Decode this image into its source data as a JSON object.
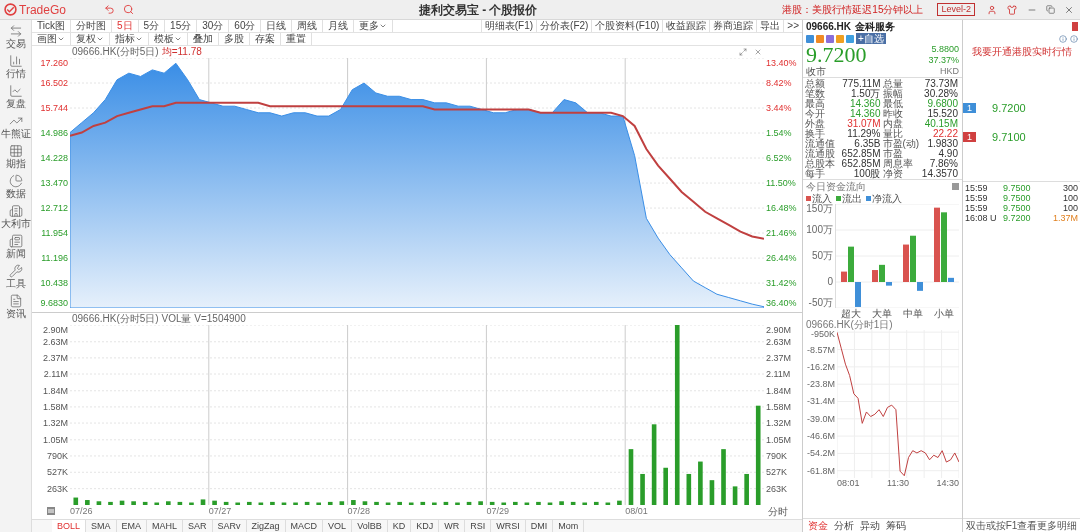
{
  "app": {
    "logo": "TradeGo",
    "title": "捷利交易宝 - 个股报价",
    "notice": "港股：美股行情延迟15分钟以上",
    "level_button": "Level-2"
  },
  "sidebar": [
    {
      "label": "交易",
      "selected": false
    },
    {
      "label": "行情",
      "selected": false
    },
    {
      "label": "复盘",
      "selected": false
    },
    {
      "label": "牛熊证",
      "selected": false
    },
    {
      "label": "期指",
      "selected": false
    },
    {
      "label": "数据",
      "selected": false
    },
    {
      "label": "大利市",
      "selected": false
    },
    {
      "label": "新闻",
      "selected": false
    },
    {
      "label": "工具",
      "selected": false
    },
    {
      "label": "资讯",
      "selected": false
    }
  ],
  "periods": [
    {
      "label": "Tick图",
      "selected": false,
      "kind": "plain"
    },
    {
      "label": "分时图",
      "selected": false,
      "kind": "plain"
    },
    {
      "label": "5日",
      "selected": true,
      "kind": "plain"
    },
    {
      "label": "5分",
      "selected": false,
      "kind": "plain"
    },
    {
      "label": "15分",
      "selected": false,
      "kind": "plain"
    },
    {
      "label": "30分",
      "selected": false,
      "kind": "plain"
    },
    {
      "label": "60分",
      "selected": false,
      "kind": "plain"
    },
    {
      "label": "日线",
      "selected": false,
      "kind": "plain"
    },
    {
      "label": "周线",
      "selected": false,
      "kind": "plain"
    },
    {
      "label": "月线",
      "selected": false,
      "kind": "plain"
    },
    {
      "label": "更多",
      "selected": false,
      "kind": "dropdown"
    }
  ],
  "panel_buttons": [
    "明细表(F1)",
    "分价表(F2)",
    "个股资料(F10)",
    "收益跟踪",
    "券商追踪",
    "导出",
    ">>"
  ],
  "tools": [
    {
      "label": "画图",
      "kind": "dropdown"
    },
    {
      "label": "复权",
      "kind": "dropdown"
    },
    {
      "label": "指标",
      "kind": "dropdown"
    },
    {
      "label": "模板",
      "kind": "dropdown"
    },
    {
      "label": "叠加",
      "kind": "plain"
    },
    {
      "label": "多股",
      "kind": "plain"
    },
    {
      "label": "存案",
      "kind": "plain"
    },
    {
      "label": "重置",
      "kind": "plain"
    }
  ],
  "price_chart": {
    "title": "09666.HK(分时5日)",
    "average": "均=11.78",
    "right_axis": [
      {
        "label": "13.40%",
        "fall": false
      },
      {
        "label": "8.42%",
        "fall": false
      },
      {
        "label": "3.44%",
        "fall": false
      },
      {
        "label": "1.54%",
        "fall": true
      },
      {
        "label": "6.52%",
        "fall": true
      },
      {
        "label": "11.50%",
        "fall": true
      },
      {
        "label": "16.48%",
        "fall": true
      },
      {
        "label": "21.46%",
        "fall": true
      },
      {
        "label": "26.44%",
        "fall": true
      },
      {
        "label": "31.42%",
        "fall": true
      },
      {
        "label": "36.40%",
        "fall": true
      }
    ],
    "chart_data": {
      "type": "area",
      "grid": true,
      "ylim": [
        9.683,
        17.26
      ],
      "yticks": [
        {
          "value": 17.26,
          "label": "17.260"
        },
        {
          "value": 16.502,
          "label": "16.502"
        },
        {
          "value": 15.744,
          "label": "15.744"
        },
        {
          "value": 14.986,
          "label": "14.986"
        },
        {
          "value": 14.228,
          "label": "14.228"
        },
        {
          "value": 13.47,
          "label": "13.470"
        },
        {
          "value": 12.712,
          "label": "12.712"
        },
        {
          "value": 11.954,
          "label": "11.954"
        },
        {
          "value": 11.196,
          "label": "11.196"
        },
        {
          "value": 10.438,
          "label": "10.438"
        },
        {
          "value": 9.683,
          "label": "9.6830"
        }
      ],
      "series": [
        {
          "type": "area",
          "color": "#3a8ee6",
          "values": [
            15.0,
            15.3,
            15.6,
            16.0,
            16.6,
            16.8,
            16.7,
            16.9,
            16.8,
            17.1,
            16.6,
            16.0,
            15.9,
            15.8,
            15.8,
            15.7,
            15.6,
            15.6,
            15.5,
            15.6,
            15.6,
            15.5,
            15.5,
            15.7,
            16.3,
            16.5,
            16.2,
            16.1,
            16.1,
            16.0,
            16.0,
            15.9,
            15.9,
            15.8,
            15.8,
            15.7,
            15.6,
            15.6,
            15.7,
            15.7,
            15.6,
            15.6,
            16.0,
            15.9,
            15.6,
            15.6,
            15.5,
            15.5,
            14.3,
            12.4,
            11.8,
            11.3,
            10.9,
            10.5,
            10.3,
            10.1,
            10.0,
            9.9,
            9.8,
            9.72
          ]
        },
        {
          "type": "line",
          "color": "#c04040",
          "values": [
            14.9,
            15.0,
            15.2,
            15.3,
            15.5,
            15.6,
            15.7,
            15.8,
            15.8,
            15.9,
            15.9,
            15.9,
            15.9,
            15.9,
            15.9,
            15.9,
            15.9,
            15.8,
            15.8,
            15.8,
            15.8,
            15.8,
            15.8,
            15.8,
            15.8,
            15.8,
            15.8,
            15.8,
            15.8,
            15.8,
            15.8,
            15.7,
            15.7,
            15.7,
            15.7,
            15.7,
            15.7,
            15.7,
            15.7,
            15.7,
            15.6,
            15.6,
            15.6,
            15.6,
            15.6,
            15.6,
            15.6,
            15.5,
            15.2,
            14.5,
            14.0,
            13.6,
            13.2,
            12.9,
            12.6,
            12.4,
            12.2,
            12.0,
            11.85,
            11.78
          ]
        }
      ]
    }
  },
  "volume_chart": {
    "title": "09666.HK(分时5日) VOL量 V=1504900",
    "right_axis": [
      "2.90M",
      "2.63M",
      "2.37M",
      "2.11M",
      "1.84M",
      "1.58M",
      "1.32M",
      "1.05M",
      "790K",
      "527K",
      "263K"
    ],
    "dates": [
      "07/26",
      "07/27",
      "07/28",
      "07/29",
      "08/01"
    ],
    "mode": "分时",
    "chart_data": {
      "type": "bar",
      "grid": true,
      "ylim": [
        0,
        2900000
      ],
      "yticks": [
        {
          "value": 2900000,
          "label": "2.90M"
        },
        {
          "value": 2630000,
          "label": "2.63M"
        },
        {
          "value": 2370000,
          "label": "2.37M"
        },
        {
          "value": 2110000,
          "label": "2.11M"
        },
        {
          "value": 1840000,
          "label": "1.84M"
        },
        {
          "value": 1580000,
          "label": "1.58M"
        },
        {
          "value": 1320000,
          "label": "1.32M"
        },
        {
          "value": 1050000,
          "label": "1.05M"
        },
        {
          "value": 790000,
          "label": "790K"
        },
        {
          "value": 527000,
          "label": "527K"
        },
        {
          "value": 263000,
          "label": "263K"
        }
      ],
      "series": [
        {
          "color": "#2a9d2a",
          "values": [
            120000,
            80000,
            60000,
            50000,
            70000,
            60000,
            50000,
            40000,
            60000,
            50000,
            40000,
            90000,
            70000,
            50000,
            40000,
            50000,
            40000,
            50000,
            40000,
            40000,
            50000,
            40000,
            50000,
            60000,
            80000,
            60000,
            50000,
            40000,
            50000,
            40000,
            50000,
            40000,
            50000,
            40000,
            50000,
            60000,
            50000,
            40000,
            50000,
            40000,
            50000,
            40000,
            60000,
            50000,
            40000,
            50000,
            40000,
            70000,
            900000,
            500000,
            1300000,
            600000,
            2900000,
            500000,
            700000,
            400000,
            900000,
            300000,
            500000,
            1600000
          ]
        }
      ]
    }
  },
  "indicators": [
    {
      "label": "BOLL",
      "selected": true
    },
    {
      "label": "SMA",
      "selected": false
    },
    {
      "label": "EMA",
      "selected": false
    },
    {
      "label": "MAHL",
      "selected": false
    },
    {
      "label": "SAR",
      "selected": false
    },
    {
      "label": "SARv",
      "selected": false
    },
    {
      "label": "ZigZag",
      "selected": false
    },
    {
      "label": "MACD",
      "selected": false
    },
    {
      "label": "VOL",
      "selected": false
    },
    {
      "label": "VolBB",
      "selected": false
    },
    {
      "label": "KD",
      "selected": false
    },
    {
      "label": "KDJ",
      "selected": false
    },
    {
      "label": "WR",
      "selected": false
    },
    {
      "label": "RSI",
      "selected": false
    },
    {
      "label": "WRSI",
      "selected": false
    },
    {
      "label": "DMI",
      "selected": false
    },
    {
      "label": "Mom",
      "selected": false
    }
  ],
  "quote": {
    "code": "09666.HK",
    "name": "金科服务",
    "watch_button": "+自选",
    "price": "9.7200",
    "change": "5.8800",
    "change_pct": "37.37%",
    "currency": "HKD",
    "status": "收市",
    "stats": [
      {
        "label": "总额",
        "value": "775.11M",
        "rise": false,
        "fall": false
      },
      {
        "label": "总量",
        "value": "73.73M",
        "rise": false,
        "fall": false
      },
      {
        "label": "笔数",
        "value": "1.50万",
        "rise": false,
        "fall": false
      },
      {
        "label": "振幅",
        "value": "30.28%",
        "rise": false,
        "fall": false
      },
      {
        "label": "最高",
        "value": "14.360",
        "rise": false,
        "fall": true
      },
      {
        "label": "最低",
        "value": "9.6800",
        "rise": false,
        "fall": true
      },
      {
        "label": "今开",
        "value": "14.360",
        "rise": false,
        "fall": true
      },
      {
        "label": "昨收",
        "value": "15.520",
        "rise": false,
        "fall": false
      },
      {
        "label": "外盘",
        "value": "31.07M",
        "rise": true,
        "fall": false
      },
      {
        "label": "内盘",
        "value": "40.15M",
        "rise": false,
        "fall": true
      },
      {
        "label": "换手",
        "value": "11.29%",
        "rise": false,
        "fall": false
      },
      {
        "label": "量比",
        "value": "22.22",
        "rise": true,
        "fall": false
      },
      {
        "label": "流通值",
        "value": "6.35B",
        "rise": false,
        "fall": false
      },
      {
        "label": "市盈(动)",
        "value": "1.9830",
        "rise": false,
        "fall": false
      },
      {
        "label": "流通股",
        "value": "652.85M",
        "rise": false,
        "fall": false
      },
      {
        "label": "市盈",
        "value": "4.90",
        "rise": false,
        "fall": false
      },
      {
        "label": "总股本",
        "value": "652.85M",
        "rise": false,
        "fall": false
      },
      {
        "label": "周息率",
        "value": "7.86%",
        "rise": false,
        "fall": false
      },
      {
        "label": "每手",
        "value": "100股",
        "rise": false,
        "fall": false
      },
      {
        "label": "净资",
        "value": "14.3570",
        "rise": false,
        "fall": false
      }
    ]
  },
  "fund_flow": {
    "title": "今日资金流向",
    "chart_data": {
      "type": "bar",
      "grid": true,
      "categories": [
        "超大",
        "大单",
        "中单",
        "小单"
      ],
      "ylim": [
        -50,
        150
      ],
      "yticks": [
        {
          "value": 150,
          "label": "150万"
        },
        {
          "value": 100,
          "label": "100万"
        },
        {
          "value": 50,
          "label": "50万"
        },
        {
          "value": 0,
          "label": "0"
        },
        {
          "value": -50,
          "label": "-50万"
        }
      ],
      "series": [
        {
          "name": "流入",
          "color": "#d9534f",
          "values": [
            20,
            23,
            72,
            143
          ]
        },
        {
          "name": "流出",
          "color": "#3cab3c",
          "values": [
            68,
            33,
            89,
            134
          ]
        },
        {
          "name": "净流入",
          "color": "#3f8fd8",
          "values": [
            -48,
            -7,
            -17,
            8
          ]
        }
      ]
    }
  },
  "flow_trend": {
    "title": "09666.HK(分时1日)",
    "times": [
      "08:01",
      "11:30",
      "14:30"
    ],
    "chart_data": {
      "type": "line",
      "grid": true,
      "ylim": [
        -65000000,
        0
      ],
      "yticks": [
        {
          "value": -950000,
          "label": "-950K"
        },
        {
          "value": -8570000,
          "label": "-8.57M"
        },
        {
          "value": -16200000,
          "label": "-16.2M"
        },
        {
          "value": -23800000,
          "label": "-23.8M"
        },
        {
          "value": -31400000,
          "label": "-31.4M"
        },
        {
          "value": -39000000,
          "label": "-39.0M"
        },
        {
          "value": -46600000,
          "label": "-46.6M"
        },
        {
          "value": -54200000,
          "label": "-54.2M"
        },
        {
          "value": -61800000,
          "label": "-61.8M"
        }
      ],
      "series": [
        {
          "color": "#c04040",
          "values": [
            -1000000,
            -8000000,
            -15000000,
            -20000000,
            -28000000,
            -30000000,
            -41000000,
            -36000000,
            -38000000,
            -37000000,
            -35000000,
            -38000000,
            -34000000,
            -33000000,
            -35000000,
            -62000000,
            -64000000,
            -56000000,
            -53000000,
            -54000000,
            -53000000,
            -54000000,
            -57000000,
            -55000000,
            -56000000,
            -53000000,
            -58000000,
            -57000000,
            -54000000,
            -58000000
          ]
        }
      ]
    }
  },
  "flow_tabs": [
    {
      "label": "资金",
      "selected": true
    },
    {
      "label": "分析",
      "selected": false
    },
    {
      "label": "异动",
      "selected": false
    },
    {
      "label": "筹码",
      "selected": false
    }
  ],
  "realtime_link": "我要开通港股实时行情",
  "order_book": [
    {
      "level": "1",
      "color": "#3f8fd8",
      "price": "9.7200"
    },
    {
      "level": "1",
      "color": "#d04040",
      "price": "9.7100"
    }
  ],
  "trades": [
    {
      "time": "15:59",
      "price": "9.7500",
      "volume": "300"
    },
    {
      "time": "15:59",
      "price": "9.7500",
      "volume": "100"
    },
    {
      "time": "15:59",
      "price": "9.7500",
      "volume": "100"
    },
    {
      "time": "16:08 U",
      "price": "9.7200",
      "volume": "1.37M"
    }
  ],
  "trades_hint": "双击或按F1查看更多明细"
}
